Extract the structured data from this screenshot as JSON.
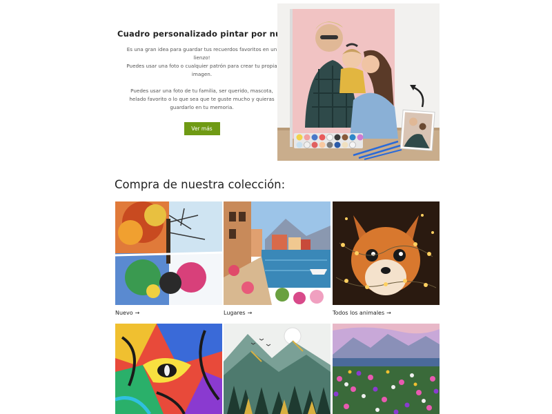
{
  "hero": {
    "title": "Cuadro personalizado pintar por números",
    "paragraph1_line1": "Es una gran idea para guardar tus recuerdos favoritos en un",
    "paragraph1_line2": "lienzo!",
    "paragraph1_line3": "Puedes usar una foto o cualquier patrón para crear tu propia",
    "paragraph1_line4": "imagen.",
    "paragraph2_line1": "Puedes usar una foto de tu familia, ser querido, mascota,",
    "paragraph2_line2": "helado favorito o lo que sea que te guste mucho y quieras",
    "paragraph2_line3": "guardarlo en tu memoria.",
    "button_label": "Ver más"
  },
  "collection": {
    "title": "Compra de nuestra colección:",
    "items": [
      {
        "label": "Nuevo",
        "arrow": "→"
      },
      {
        "label": "Lugares",
        "arrow": "→"
      },
      {
        "label": "Todos los animales",
        "arrow": "→"
      },
      {
        "label": "",
        "arrow": ""
      },
      {
        "label": "",
        "arrow": ""
      },
      {
        "label": "",
        "arrow": ""
      }
    ]
  },
  "colors": {
    "button": "#6f9a14",
    "text": "#222222"
  }
}
